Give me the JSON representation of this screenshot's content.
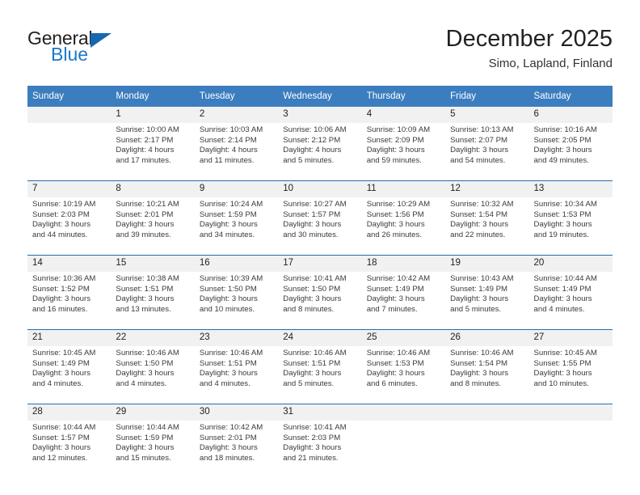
{
  "brand": {
    "word1": "General",
    "word2": "Blue",
    "triangle_color": "#1567b2",
    "word2_color": "#1b79c9"
  },
  "header": {
    "title": "December 2025",
    "subtitle": "Simo, Lapland, Finland"
  },
  "theme": {
    "header_bg": "#3b7dbf",
    "daynum_bg": "#f1f1f1",
    "rule_color": "#2b6cab",
    "text_color": "#3a3a3a"
  },
  "weekdays": [
    "Sunday",
    "Monday",
    "Tuesday",
    "Wednesday",
    "Thursday",
    "Friday",
    "Saturday"
  ],
  "weeks": [
    {
      "days": [
        {
          "num": "",
          "sunrise": "",
          "sunset": "",
          "daylight1": "",
          "daylight2": ""
        },
        {
          "num": "1",
          "sunrise": "Sunrise: 10:00 AM",
          "sunset": "Sunset: 2:17 PM",
          "daylight1": "Daylight: 4 hours",
          "daylight2": "and 17 minutes."
        },
        {
          "num": "2",
          "sunrise": "Sunrise: 10:03 AM",
          "sunset": "Sunset: 2:14 PM",
          "daylight1": "Daylight: 4 hours",
          "daylight2": "and 11 minutes."
        },
        {
          "num": "3",
          "sunrise": "Sunrise: 10:06 AM",
          "sunset": "Sunset: 2:12 PM",
          "daylight1": "Daylight: 4 hours",
          "daylight2": "and 5 minutes."
        },
        {
          "num": "4",
          "sunrise": "Sunrise: 10:09 AM",
          "sunset": "Sunset: 2:09 PM",
          "daylight1": "Daylight: 3 hours",
          "daylight2": "and 59 minutes."
        },
        {
          "num": "5",
          "sunrise": "Sunrise: 10:13 AM",
          "sunset": "Sunset: 2:07 PM",
          "daylight1": "Daylight: 3 hours",
          "daylight2": "and 54 minutes."
        },
        {
          "num": "6",
          "sunrise": "Sunrise: 10:16 AM",
          "sunset": "Sunset: 2:05 PM",
          "daylight1": "Daylight: 3 hours",
          "daylight2": "and 49 minutes."
        }
      ]
    },
    {
      "days": [
        {
          "num": "7",
          "sunrise": "Sunrise: 10:19 AM",
          "sunset": "Sunset: 2:03 PM",
          "daylight1": "Daylight: 3 hours",
          "daylight2": "and 44 minutes."
        },
        {
          "num": "8",
          "sunrise": "Sunrise: 10:21 AM",
          "sunset": "Sunset: 2:01 PM",
          "daylight1": "Daylight: 3 hours",
          "daylight2": "and 39 minutes."
        },
        {
          "num": "9",
          "sunrise": "Sunrise: 10:24 AM",
          "sunset": "Sunset: 1:59 PM",
          "daylight1": "Daylight: 3 hours",
          "daylight2": "and 34 minutes."
        },
        {
          "num": "10",
          "sunrise": "Sunrise: 10:27 AM",
          "sunset": "Sunset: 1:57 PM",
          "daylight1": "Daylight: 3 hours",
          "daylight2": "and 30 minutes."
        },
        {
          "num": "11",
          "sunrise": "Sunrise: 10:29 AM",
          "sunset": "Sunset: 1:56 PM",
          "daylight1": "Daylight: 3 hours",
          "daylight2": "and 26 minutes."
        },
        {
          "num": "12",
          "sunrise": "Sunrise: 10:32 AM",
          "sunset": "Sunset: 1:54 PM",
          "daylight1": "Daylight: 3 hours",
          "daylight2": "and 22 minutes."
        },
        {
          "num": "13",
          "sunrise": "Sunrise: 10:34 AM",
          "sunset": "Sunset: 1:53 PM",
          "daylight1": "Daylight: 3 hours",
          "daylight2": "and 19 minutes."
        }
      ]
    },
    {
      "days": [
        {
          "num": "14",
          "sunrise": "Sunrise: 10:36 AM",
          "sunset": "Sunset: 1:52 PM",
          "daylight1": "Daylight: 3 hours",
          "daylight2": "and 16 minutes."
        },
        {
          "num": "15",
          "sunrise": "Sunrise: 10:38 AM",
          "sunset": "Sunset: 1:51 PM",
          "daylight1": "Daylight: 3 hours",
          "daylight2": "and 13 minutes."
        },
        {
          "num": "16",
          "sunrise": "Sunrise: 10:39 AM",
          "sunset": "Sunset: 1:50 PM",
          "daylight1": "Daylight: 3 hours",
          "daylight2": "and 10 minutes."
        },
        {
          "num": "17",
          "sunrise": "Sunrise: 10:41 AM",
          "sunset": "Sunset: 1:50 PM",
          "daylight1": "Daylight: 3 hours",
          "daylight2": "and 8 minutes."
        },
        {
          "num": "18",
          "sunrise": "Sunrise: 10:42 AM",
          "sunset": "Sunset: 1:49 PM",
          "daylight1": "Daylight: 3 hours",
          "daylight2": "and 7 minutes."
        },
        {
          "num": "19",
          "sunrise": "Sunrise: 10:43 AM",
          "sunset": "Sunset: 1:49 PM",
          "daylight1": "Daylight: 3 hours",
          "daylight2": "and 5 minutes."
        },
        {
          "num": "20",
          "sunrise": "Sunrise: 10:44 AM",
          "sunset": "Sunset: 1:49 PM",
          "daylight1": "Daylight: 3 hours",
          "daylight2": "and 4 minutes."
        }
      ]
    },
    {
      "days": [
        {
          "num": "21",
          "sunrise": "Sunrise: 10:45 AM",
          "sunset": "Sunset: 1:49 PM",
          "daylight1": "Daylight: 3 hours",
          "daylight2": "and 4 minutes."
        },
        {
          "num": "22",
          "sunrise": "Sunrise: 10:46 AM",
          "sunset": "Sunset: 1:50 PM",
          "daylight1": "Daylight: 3 hours",
          "daylight2": "and 4 minutes."
        },
        {
          "num": "23",
          "sunrise": "Sunrise: 10:46 AM",
          "sunset": "Sunset: 1:51 PM",
          "daylight1": "Daylight: 3 hours",
          "daylight2": "and 4 minutes."
        },
        {
          "num": "24",
          "sunrise": "Sunrise: 10:46 AM",
          "sunset": "Sunset: 1:51 PM",
          "daylight1": "Daylight: 3 hours",
          "daylight2": "and 5 minutes."
        },
        {
          "num": "25",
          "sunrise": "Sunrise: 10:46 AM",
          "sunset": "Sunset: 1:53 PM",
          "daylight1": "Daylight: 3 hours",
          "daylight2": "and 6 minutes."
        },
        {
          "num": "26",
          "sunrise": "Sunrise: 10:46 AM",
          "sunset": "Sunset: 1:54 PM",
          "daylight1": "Daylight: 3 hours",
          "daylight2": "and 8 minutes."
        },
        {
          "num": "27",
          "sunrise": "Sunrise: 10:45 AM",
          "sunset": "Sunset: 1:55 PM",
          "daylight1": "Daylight: 3 hours",
          "daylight2": "and 10 minutes."
        }
      ]
    },
    {
      "days": [
        {
          "num": "28",
          "sunrise": "Sunrise: 10:44 AM",
          "sunset": "Sunset: 1:57 PM",
          "daylight1": "Daylight: 3 hours",
          "daylight2": "and 12 minutes."
        },
        {
          "num": "29",
          "sunrise": "Sunrise: 10:44 AM",
          "sunset": "Sunset: 1:59 PM",
          "daylight1": "Daylight: 3 hours",
          "daylight2": "and 15 minutes."
        },
        {
          "num": "30",
          "sunrise": "Sunrise: 10:42 AM",
          "sunset": "Sunset: 2:01 PM",
          "daylight1": "Daylight: 3 hours",
          "daylight2": "and 18 minutes."
        },
        {
          "num": "31",
          "sunrise": "Sunrise: 10:41 AM",
          "sunset": "Sunset: 2:03 PM",
          "daylight1": "Daylight: 3 hours",
          "daylight2": "and 21 minutes."
        },
        {
          "num": "",
          "sunrise": "",
          "sunset": "",
          "daylight1": "",
          "daylight2": ""
        },
        {
          "num": "",
          "sunrise": "",
          "sunset": "",
          "daylight1": "",
          "daylight2": ""
        },
        {
          "num": "",
          "sunrise": "",
          "sunset": "",
          "daylight1": "",
          "daylight2": ""
        }
      ]
    }
  ]
}
